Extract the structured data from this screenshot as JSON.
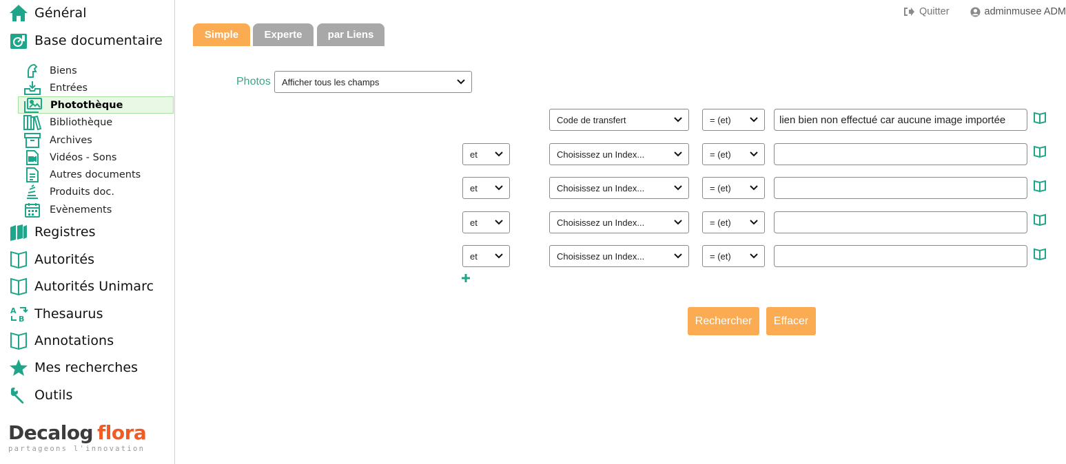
{
  "sidebar": {
    "top_items": [
      {
        "label": "Général",
        "icon": "home-icon"
      },
      {
        "label": "Base documentaire",
        "icon": "documentary-base-icon"
      }
    ],
    "sub_items": [
      {
        "label": "Biens",
        "icon": "horse-icon"
      },
      {
        "label": "Entrées",
        "icon": "inbox-download-icon"
      },
      {
        "label": "Photothèque",
        "icon": "photos-icon",
        "active": true
      },
      {
        "label": "Bibliothèque",
        "icon": "books-icon"
      },
      {
        "label": "Archives",
        "icon": "archive-box-icon"
      },
      {
        "label": "Vidéos - Sons",
        "icon": "video-file-icon"
      },
      {
        "label": "Autres documents",
        "icon": "document-icon"
      },
      {
        "label": "Produits doc.",
        "icon": "stack-icon"
      },
      {
        "label": "Evènements",
        "icon": "calendar-icon"
      }
    ],
    "bottom_items": [
      {
        "label": "Registres",
        "icon": "registers-icon"
      },
      {
        "label": "Autorités",
        "icon": "open-book-icon"
      },
      {
        "label": "Autorités Unimarc",
        "icon": "open-book-icon"
      },
      {
        "label": "Thesaurus",
        "icon": "thesaurus-icon"
      },
      {
        "label": "Annotations",
        "icon": "open-book-icon"
      },
      {
        "label": "Mes recherches",
        "icon": "star-icon"
      },
      {
        "label": "Outils",
        "icon": "wrench-icon"
      }
    ],
    "logo": {
      "part1": "Decalog",
      "part2": "flora",
      "tagline": "partageons l'innovation"
    }
  },
  "topbar": {
    "quit_label": "Quitter",
    "user_label": "adminmusee ADM"
  },
  "tabs": [
    {
      "label": "Simple",
      "active": true
    },
    {
      "label": "Experte",
      "active": false
    },
    {
      "label": "par Liens",
      "active": false
    }
  ],
  "form": {
    "base_label": "Photos",
    "fields_select": "Afficher tous les champs",
    "rows": [
      {
        "connector": "",
        "field": "Code de transfert",
        "operator": "= (et)",
        "value": "lien bien non effectué car aucune image importée"
      },
      {
        "connector": "et",
        "field": "Choisissez un Index...",
        "operator": "= (et)",
        "value": ""
      },
      {
        "connector": "et",
        "field": "Choisissez un Index...",
        "operator": "= (et)",
        "value": ""
      },
      {
        "connector": "et",
        "field": "Choisissez un Index...",
        "operator": "= (et)",
        "value": ""
      },
      {
        "connector": "et",
        "field": "Choisissez un Index...",
        "operator": "= (et)",
        "value": ""
      }
    ],
    "add_row_symbol": "+",
    "search_button": "Rechercher",
    "clear_button": "Effacer"
  },
  "colors": {
    "accent_green": "#1fa68a",
    "accent_orange": "#fbab52",
    "tab_inactive": "#a8a8a8",
    "brand_orange": "#f15a24"
  }
}
